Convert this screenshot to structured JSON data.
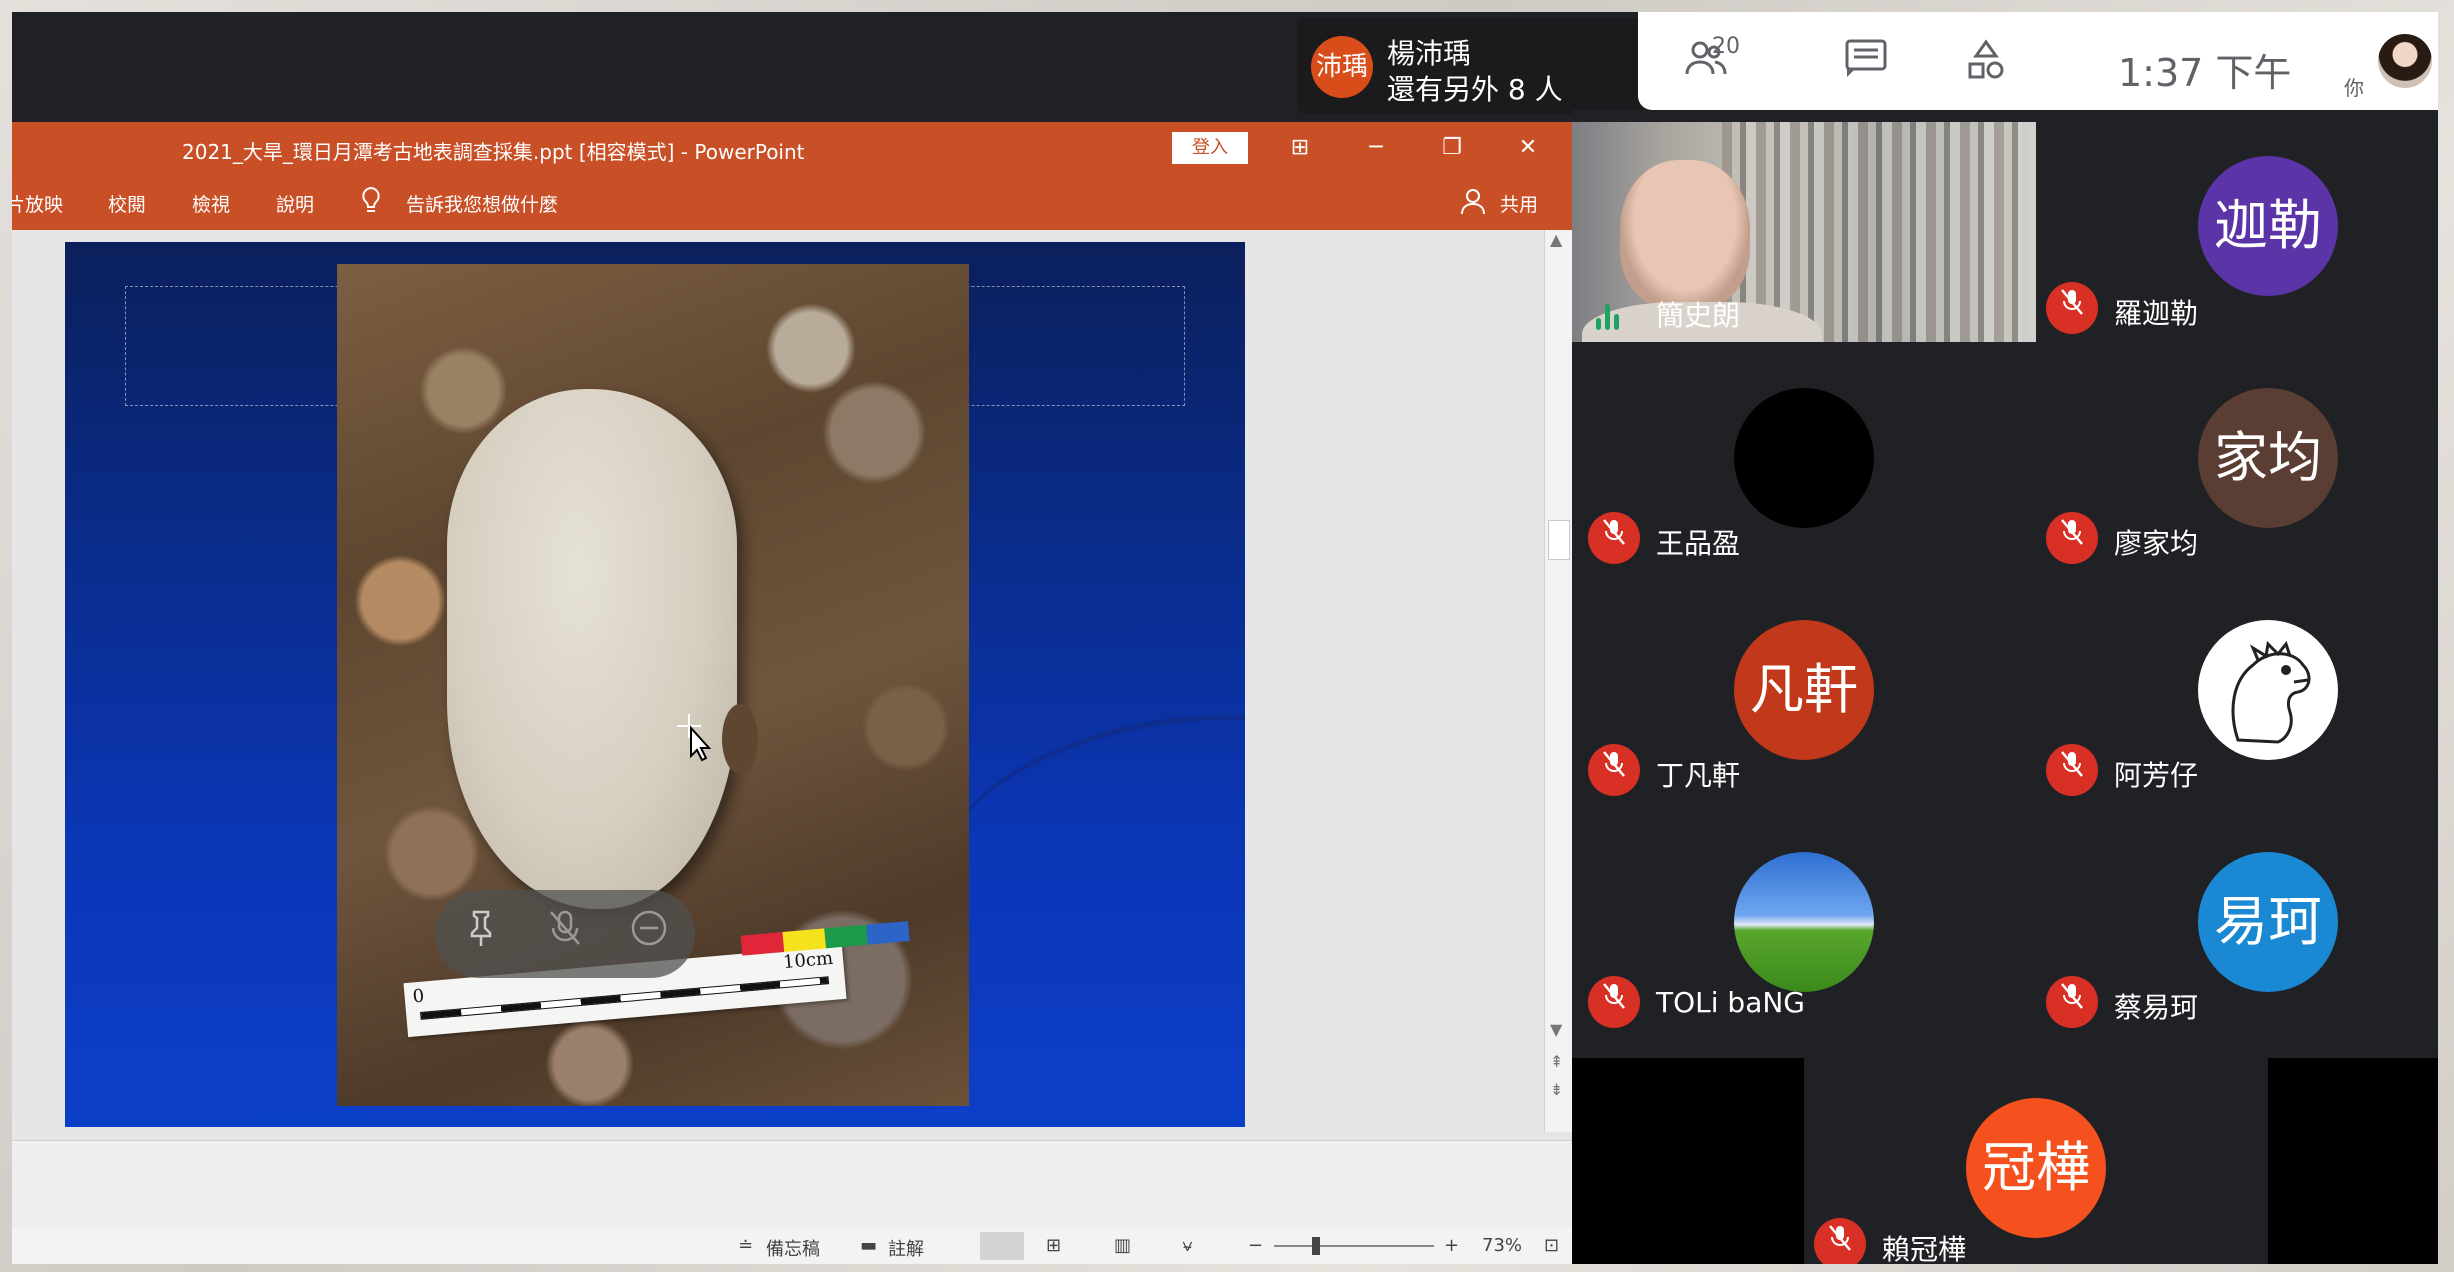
{
  "meet": {
    "presenter": {
      "avatar_text": "沛瑀",
      "avatar_color": "#d84d1a",
      "name": "楊沛瑀",
      "more": "還有另外 8 人"
    },
    "controls": {
      "people_icon": "people-icon",
      "people_count": "20",
      "chat_icon": "chat-icon",
      "activities_icon": "activities-icon",
      "clock": "1:37 下午",
      "self_label": "你"
    }
  },
  "ppt": {
    "title": "2021_大旱_環日月潭考古地表調查採集.ppt [相容模式] - PowerPoint",
    "login_label": "登入",
    "window_buttons": {
      "layout": "⊞",
      "minimize": "─",
      "restore": "❐",
      "close": "✕"
    },
    "ribbon_tabs": [
      "片放映",
      "校閱",
      "檢視",
      "說明"
    ],
    "tell_me": "告訴我您想做什麼",
    "share_label": "共用",
    "slide": {
      "scale_zero": "0",
      "scale_label": "10cm",
      "scale_colors": [
        "#e2263a",
        "#f6e21c",
        "#1a9a4a",
        "#2d64c8"
      ]
    },
    "status": {
      "notes_label": "備忘稿",
      "comments_label": "註解",
      "zoom_minus": "−",
      "zoom_plus": "+",
      "zoom_level": "73%",
      "zoom_fraction": 0.24
    }
  },
  "participants": [
    {
      "name": "簡史朗",
      "type": "video",
      "speaking": true
    },
    {
      "name": "羅迦勒",
      "avatar_text": "迦勒",
      "color": "#5b34a8",
      "muted": true
    },
    {
      "name": "王品盈",
      "avatar_text": "",
      "color": "#000000",
      "muted": true
    },
    {
      "name": "廖家均",
      "avatar_text": "家均",
      "color": "#5a3d33",
      "muted": true
    },
    {
      "name": "丁凡軒",
      "avatar_text": "凡軒",
      "color": "#c2381a",
      "muted": true
    },
    {
      "name": "阿芳仔",
      "avatar_text": "",
      "color": "#ffffff",
      "muted": true,
      "image": "dinosaur-avatar"
    },
    {
      "name": "TOLi baNG",
      "avatar_text": "",
      "color": "#3a8a1c",
      "muted": true,
      "image": "landscape-avatar"
    },
    {
      "name": "蔡易珂",
      "avatar_text": "易珂",
      "color": "#1a88d2",
      "muted": true
    },
    {
      "name": "賴冠樺",
      "avatar_text": "冠樺",
      "color": "#f4511e",
      "muted": true
    }
  ]
}
